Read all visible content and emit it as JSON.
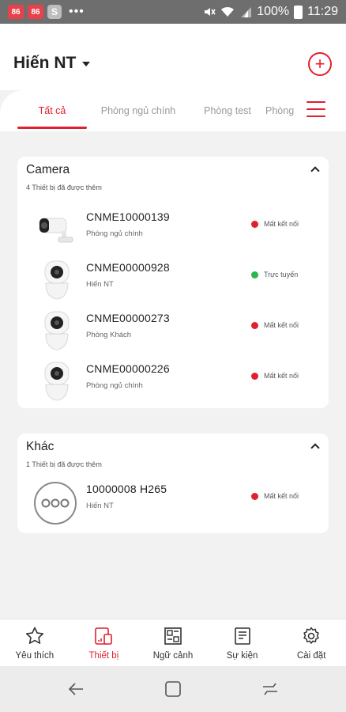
{
  "status_bar": {
    "app_icon_label": "86",
    "s_label": "S",
    "dots": "•••",
    "battery": "100%",
    "time": "11:29"
  },
  "header": {
    "account_name": "Hiến NT",
    "add_label": "+"
  },
  "tabs": [
    {
      "label": "Tất cả",
      "active": true
    },
    {
      "label": "Phòng ngủ chính",
      "active": false
    },
    {
      "label": "Phòng test",
      "active": false
    },
    {
      "label": "Phòng",
      "active": false
    }
  ],
  "colors": {
    "accent": "#e0202e",
    "offline": "#e0202e",
    "online": "#2bb64a"
  },
  "camera_section": {
    "title": "Camera",
    "subtitle": "4 Thiết bị đã được thêm",
    "devices": [
      {
        "name": "CNME10000139",
        "room": "Phòng ngủ chính",
        "status": "Mất kết nối",
        "icon": "bullet-camera-icon"
      },
      {
        "name": "CNME00000928",
        "room": "Hiến NT",
        "status": "Trực tuyến",
        "icon": "dome-camera-icon"
      },
      {
        "name": "CNME00000273",
        "room": "Phòng Khách",
        "status": "Mất kết nối",
        "icon": "dome-camera-icon"
      },
      {
        "name": "CNME00000226",
        "room": "Phòng ngủ chính",
        "status": "Mất kết nối",
        "icon": "dome-camera-icon"
      }
    ]
  },
  "other_section": {
    "title": "Khác",
    "subtitle": "1 Thiết bị đã được thêm",
    "devices": [
      {
        "name": "10000008 H265",
        "room": "Hiến NT",
        "status": "Mất kết nối",
        "icon": "more-device-icon"
      }
    ]
  },
  "bottom_nav": [
    {
      "label": "Yêu thích",
      "icon": "star-icon",
      "active": false
    },
    {
      "label": "Thiết bị",
      "icon": "devices-icon",
      "active": true
    },
    {
      "label": "Ngữ cảnh",
      "icon": "scene-icon",
      "active": false
    },
    {
      "label": "Sự kiện",
      "icon": "events-icon",
      "active": false
    },
    {
      "label": "Cài đặt",
      "icon": "gear-icon",
      "active": false
    }
  ]
}
